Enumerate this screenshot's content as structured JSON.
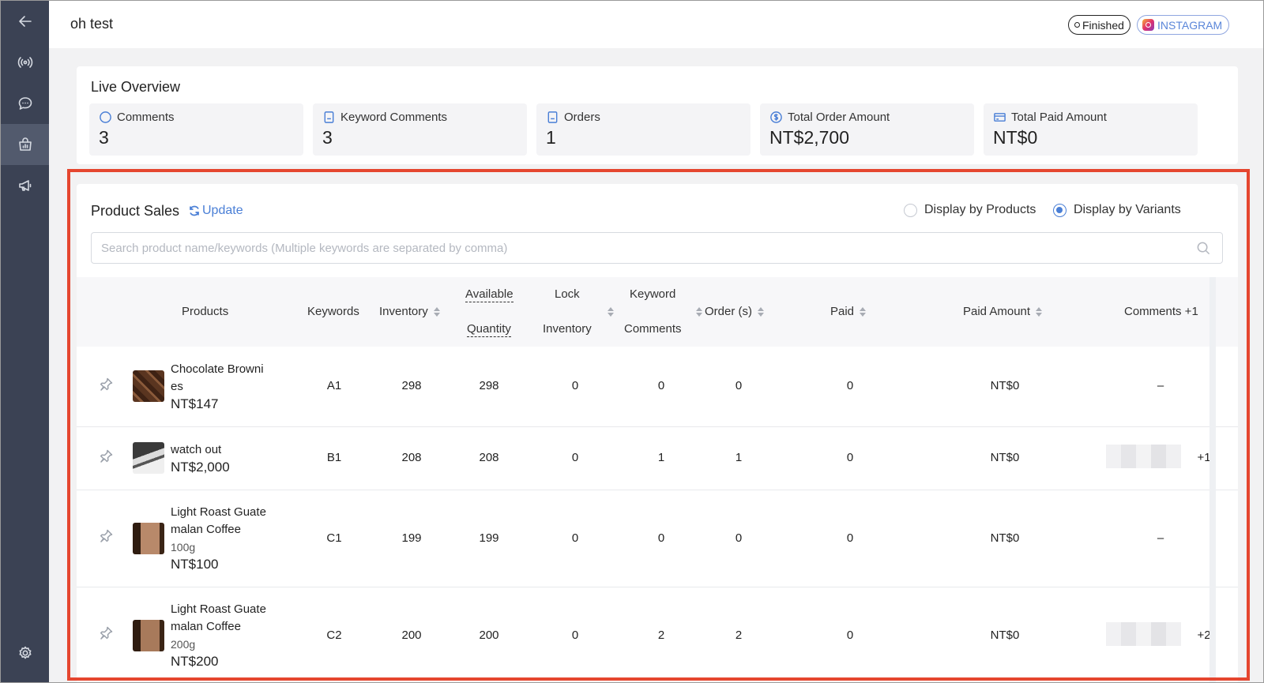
{
  "header": {
    "title": "oh test",
    "status_badge": "Finished",
    "platform_badge": "INSTAGRAM"
  },
  "sidebar": {
    "items": [
      {
        "icon": "back-arrow-icon"
      },
      {
        "icon": "live-broadcast-icon"
      },
      {
        "icon": "chat-icon"
      },
      {
        "icon": "store-analytics-icon",
        "active": true
      },
      {
        "icon": "megaphone-icon"
      },
      {
        "icon": "gear-icon"
      }
    ]
  },
  "overview": {
    "title": "Live Overview",
    "stats": [
      {
        "label": "Comments",
        "value": "3",
        "icon": "comment-icon"
      },
      {
        "label": "Keyword Comments",
        "value": "3",
        "icon": "document-icon"
      },
      {
        "label": "Orders",
        "value": "1",
        "icon": "document-icon"
      },
      {
        "label": "Total Order Amount",
        "value": "NT$2,700",
        "icon": "dollar-icon"
      },
      {
        "label": "Total Paid Amount",
        "value": "NT$0",
        "icon": "card-icon"
      }
    ]
  },
  "sales": {
    "title": "Product Sales",
    "update_label": "Update",
    "display_by_products": "Display by Products",
    "display_by_variants": "Display by Variants",
    "selected_display": "variants",
    "search_placeholder": "Search product name/keywords (Multiple keywords are separated by comma)",
    "columns": {
      "products": "Products",
      "keywords": "Keywords",
      "inventory": "Inventory",
      "available_1": "Available",
      "available_2": "Quantity",
      "lock_1": "Lock",
      "lock_2": "Inventory",
      "kwc_1": "Keyword",
      "kwc_2": "Comments",
      "orders": "Order (s)",
      "paid": "Paid",
      "paid_amount": "Paid Amount",
      "comments": "Comments +1"
    },
    "rows": [
      {
        "name_1": "Chocolate Browni",
        "name_2": "es",
        "variant": "",
        "price": "NT$147",
        "keyword": "A1",
        "inventory": "298",
        "available": "298",
        "lock": "0",
        "kw_comments": "0",
        "orders": "0",
        "paid": "0",
        "paid_amount": "NT$0",
        "comments": "–"
      },
      {
        "name_1": "watch out",
        "name_2": "",
        "variant": "",
        "price": "NT$2,000",
        "keyword": "B1",
        "inventory": "208",
        "available": "208",
        "lock": "0",
        "kw_comments": "1",
        "orders": "1",
        "paid": "0",
        "paid_amount": "NT$0",
        "comments": "+1"
      },
      {
        "name_1": "Light Roast Guate",
        "name_2": "malan Coffee",
        "variant": "100g",
        "price": "NT$100",
        "keyword": "C1",
        "inventory": "199",
        "available": "199",
        "lock": "0",
        "kw_comments": "0",
        "orders": "0",
        "paid": "0",
        "paid_amount": "NT$0",
        "comments": "–"
      },
      {
        "name_1": "Light Roast Guate",
        "name_2": "malan Coffee",
        "variant": "200g",
        "price": "NT$200",
        "keyword": "C2",
        "inventory": "200",
        "available": "200",
        "lock": "0",
        "kw_comments": "2",
        "orders": "2",
        "paid": "0",
        "paid_amount": "NT$0",
        "comments": "+2"
      }
    ]
  },
  "colors": {
    "accent": "#4a7fd6",
    "sidebar": "#3b4254",
    "highlight": "#e5462f"
  }
}
